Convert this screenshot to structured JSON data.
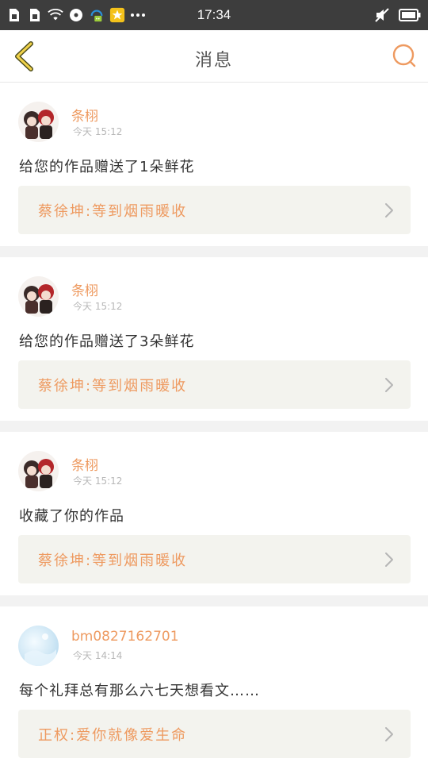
{
  "status_bar": {
    "time": "17:34"
  },
  "nav": {
    "title": "消息"
  },
  "messages": [
    {
      "user": "条栩",
      "time": "今天 15:12",
      "text": "给您的作品赠送了1朵鲜花",
      "ref": "蔡徐坤:等到烟雨暖收"
    },
    {
      "user": "条栩",
      "time": "今天 15:12",
      "text": "给您的作品赠送了3朵鲜花",
      "ref": "蔡徐坤:等到烟雨暖收"
    },
    {
      "user": "条栩",
      "time": "今天 15:12",
      "text": "收藏了你的作品",
      "ref": "蔡徐坤:等到烟雨暖收"
    },
    {
      "user": "bm0827162701",
      "time": "今天 14:14",
      "text": "每个礼拜总有那么六七天想看文……",
      "ref": "正权:爱你就像爱生命"
    }
  ],
  "colors": {
    "accent": "#ee9a60",
    "status_bar": "#3d3d3d",
    "ref_bg": "#f3f3ee"
  },
  "icons": {
    "back": "chevron-left-icon",
    "search": "search-icon"
  }
}
